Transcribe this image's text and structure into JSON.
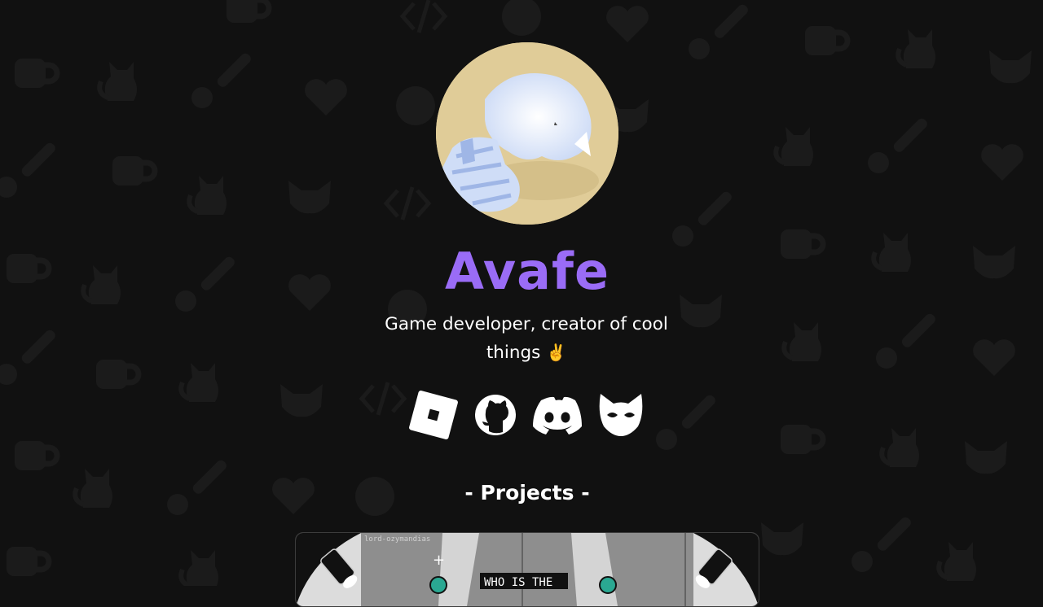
{
  "profile": {
    "name": "Avafe",
    "tagline": "Game developer, creator of cool things",
    "tagline_emoji": "✌️",
    "avatar_icon": "sleeping-cat-avatar"
  },
  "social_links": [
    {
      "icon": "roblox-icon"
    },
    {
      "icon": "github-icon"
    },
    {
      "icon": "discord-icon"
    },
    {
      "icon": "cat-mask-icon"
    }
  ],
  "projects": {
    "heading": "- Projects -",
    "cards": [
      {
        "image_credit": "lord-ozymandias",
        "image_text": "WHO IS THE"
      }
    ]
  },
  "colors": {
    "background": "#111111",
    "accent": "#9a6cf6",
    "text": "#ffffff",
    "pattern": "#1b1b1b"
  },
  "background_icons": [
    "coffee-cup-icon",
    "cat-icon",
    "wrench-icon",
    "heart-icon",
    "gamepad-icon",
    "code-icon",
    "cat-mask-icon"
  ]
}
